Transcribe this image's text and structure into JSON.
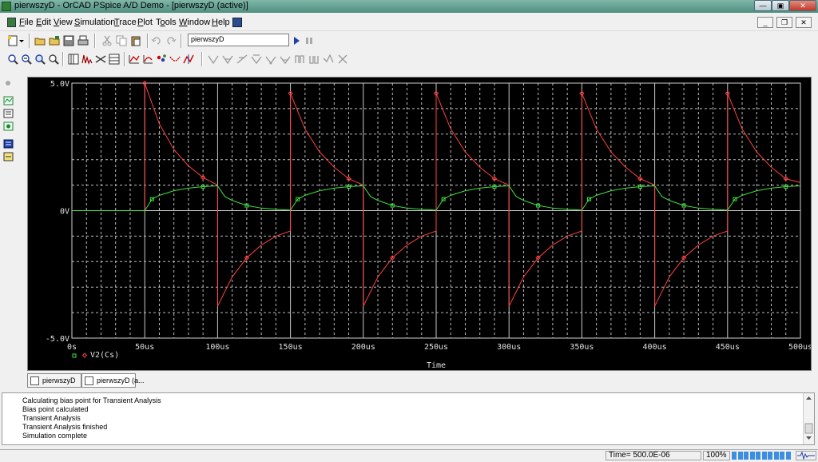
{
  "window": {
    "title": "pierwszyD - OrCAD PSpice A/D Demo - [pierwszyD (active)]",
    "minimize": "—",
    "maximize": "▣",
    "close": "✕"
  },
  "menu": {
    "items": [
      {
        "label": "File",
        "u": "F",
        "rest": "ile"
      },
      {
        "label": "Edit",
        "u": "E",
        "rest": "dit"
      },
      {
        "label": "View",
        "u": "V",
        "rest": "iew"
      },
      {
        "label": "Simulation",
        "u": "S",
        "rest": "imulation"
      },
      {
        "label": "Trace",
        "u": "T",
        "rest": "race"
      },
      {
        "label": "Plot",
        "u": "P",
        "rest": "lot"
      },
      {
        "label": "Tools",
        "pre": "T",
        "u": "o",
        "rest": "ols"
      },
      {
        "label": "Window",
        "u": "W",
        "rest": "indow"
      },
      {
        "label": "Help",
        "u": "H",
        "rest": "elp"
      }
    ],
    "mdi_minimize": "_",
    "mdi_restore": "❐",
    "mdi_close": "✕"
  },
  "toolbar": {
    "simulation_profile": "pierwszyD"
  },
  "chart_data": {
    "type": "line",
    "xlabel": "Time",
    "ylabel": "",
    "xlim": [
      0,
      500
    ],
    "ylim": [
      -5,
      5
    ],
    "x_ticks": [
      "0s",
      "50us",
      "100us",
      "150us",
      "200us",
      "250us",
      "300us",
      "350us",
      "400us",
      "450us",
      "500us"
    ],
    "y_ticks": [
      "5.0V",
      "0V",
      "-5.0V"
    ],
    "grid": true,
    "legend": "bottom-left",
    "series": [
      {
        "name": "V2(Cs)",
        "color": "#ff4040",
        "marker": "diamond",
        "x": [
          0,
          50,
          50,
          60,
          70,
          80,
          90,
          100,
          100,
          110,
          120,
          130,
          140,
          150,
          150,
          160,
          170,
          180,
          190,
          200,
          200,
          210,
          220,
          230,
          240,
          250,
          250,
          260,
          270,
          280,
          290,
          300,
          300,
          310,
          320,
          330,
          340,
          350,
          350,
          360,
          370,
          380,
          390,
          400,
          400,
          410,
          420,
          430,
          440,
          450,
          450,
          460,
          470,
          480,
          490,
          500
        ],
        "y": [
          0,
          0,
          5.0,
          3.4,
          2.4,
          1.75,
          1.3,
          1.0,
          -3.75,
          -2.6,
          -1.85,
          -1.35,
          -1.0,
          -0.8,
          4.6,
          3.2,
          2.3,
          1.7,
          1.25,
          1.0,
          -3.75,
          -2.6,
          -1.85,
          -1.35,
          -1.0,
          -0.8,
          4.6,
          3.2,
          2.3,
          1.7,
          1.25,
          1.0,
          -3.75,
          -2.6,
          -1.85,
          -1.35,
          -1.0,
          -0.8,
          4.6,
          3.2,
          2.3,
          1.7,
          1.25,
          1.0,
          -3.75,
          -2.6,
          -1.85,
          -1.35,
          -1.0,
          -0.8,
          4.6,
          3.2,
          2.3,
          1.7,
          1.25,
          1.1
        ]
      },
      {
        "name": "",
        "color": "#40e040",
        "marker": "square",
        "x": [
          0,
          50,
          55,
          60,
          70,
          80,
          90,
          100,
          105,
          110,
          120,
          130,
          140,
          150,
          155,
          160,
          170,
          180,
          190,
          200,
          205,
          210,
          220,
          230,
          240,
          250,
          255,
          260,
          270,
          280,
          290,
          300,
          305,
          310,
          320,
          330,
          340,
          350,
          355,
          360,
          370,
          380,
          390,
          400,
          405,
          410,
          420,
          430,
          440,
          450,
          455,
          460,
          470,
          480,
          490,
          500
        ],
        "y": [
          0,
          0,
          0.45,
          0.6,
          0.78,
          0.88,
          0.94,
          0.97,
          0.55,
          0.4,
          0.2,
          0.1,
          0.05,
          0.02,
          0.45,
          0.6,
          0.78,
          0.88,
          0.94,
          0.97,
          0.55,
          0.4,
          0.2,
          0.1,
          0.05,
          0.02,
          0.45,
          0.6,
          0.78,
          0.88,
          0.94,
          0.97,
          0.55,
          0.4,
          0.2,
          0.1,
          0.05,
          0.02,
          0.45,
          0.6,
          0.78,
          0.88,
          0.94,
          0.97,
          0.55,
          0.4,
          0.2,
          0.1,
          0.05,
          0.02,
          0.45,
          0.6,
          0.78,
          0.88,
          0.94,
          0.97
        ]
      }
    ]
  },
  "tabs": [
    {
      "label": "pierwszyD"
    },
    {
      "label": "pierwszyD (a..."
    }
  ],
  "output": {
    "lines": [
      "Calculating bias point for Transient Analysis",
      "Bias point calculated",
      "Transient Analysis",
      "Transient Analysis finished",
      "Simulation complete"
    ]
  },
  "status": {
    "time": "Time= 500.0E-06",
    "zoom": "100%",
    "progress_percent": 100
  }
}
